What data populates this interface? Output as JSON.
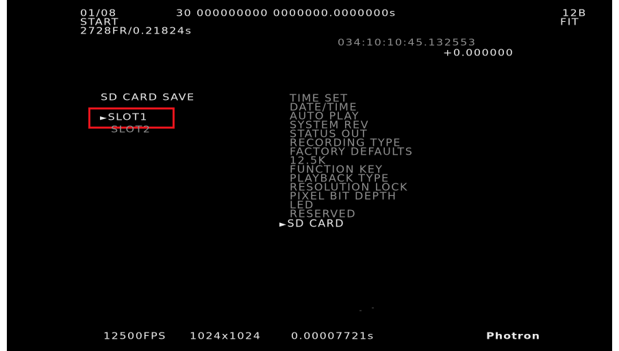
{
  "header": {
    "frame_index": "01/08",
    "trigger_mode": "START",
    "frame_count_time": "2728FR/0.21824s",
    "counter": "30 000000000 0000000.0000000s",
    "bit_depth": "12B",
    "fit": "FIT",
    "timecode": "034:10:10:45.132553",
    "offset": "+0.000000"
  },
  "submenu": {
    "title": "SD CARD SAVE",
    "selected_marker": "►",
    "items": [
      {
        "label": "SLOT1",
        "selected": true
      },
      {
        "label": "SLOT2",
        "selected": false
      }
    ]
  },
  "menu": {
    "selected_marker": "►",
    "items": [
      {
        "label": "TIME SET"
      },
      {
        "label": "DATE/TIME"
      },
      {
        "label": "AUTO PLAY"
      },
      {
        "label": "SYSTEM REV"
      },
      {
        "label": "STATUS OUT"
      },
      {
        "label": "RECORDING TYPE"
      },
      {
        "label": "FACTORY DEFAULTS"
      },
      {
        "label": "12.5K"
      },
      {
        "label": "FUNCTION KEY"
      },
      {
        "label": "PLAYBACK TYPE"
      },
      {
        "label": "RESOLUTION LOCK"
      },
      {
        "label": "PIXEL BIT DEPTH"
      },
      {
        "label": "LED"
      },
      {
        "label": "RESERVED"
      },
      {
        "label": "SD CARD",
        "selected": true
      }
    ]
  },
  "footer": {
    "fps": "12500FPS",
    "resolution": "1024x1024",
    "shutter": "0.00007721s",
    "brand": "Photron"
  },
  "colors": {
    "background": "#000000",
    "text": "#e8e8e8",
    "text_dim": "#8e8e8e",
    "highlight_box": "#e8141c"
  }
}
